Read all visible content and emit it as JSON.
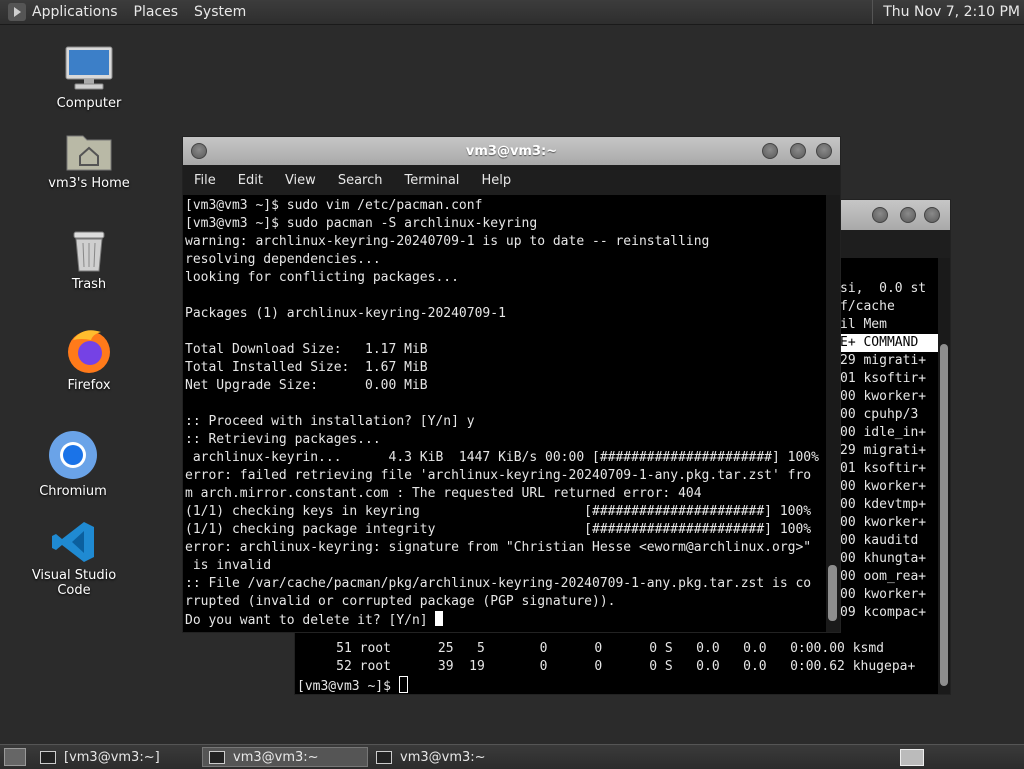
{
  "top_panel": {
    "menus": [
      "Applications",
      "Places",
      "System"
    ],
    "clock": "Thu Nov  7,  2:10 PM"
  },
  "desktop": {
    "icons": [
      {
        "label": "Computer",
        "icon": "computer-icon"
      },
      {
        "label": "vm3's Home",
        "icon": "home-folder-icon"
      },
      {
        "label": "Trash",
        "icon": "trash-icon"
      },
      {
        "label": "Firefox",
        "icon": "firefox-icon"
      },
      {
        "label": "Chromium",
        "icon": "chromium-icon"
      },
      {
        "label": "Visual Studio Code",
        "icon": "vscode-icon"
      }
    ]
  },
  "front_terminal": {
    "title": "vm3@vm3:~",
    "menus": [
      "File",
      "Edit",
      "View",
      "Search",
      "Terminal",
      "Help"
    ],
    "lines": [
      "[vm3@vm3 ~]$ sudo vim /etc/pacman.conf",
      "[vm3@vm3 ~]$ sudo pacman -S archlinux-keyring",
      "warning: archlinux-keyring-20240709-1 is up to date -- reinstalling",
      "resolving dependencies...",
      "looking for conflicting packages...",
      "",
      "Packages (1) archlinux-keyring-20240709-1",
      "",
      "Total Download Size:   1.17 MiB",
      "Total Installed Size:  1.67 MiB",
      "Net Upgrade Size:      0.00 MiB",
      "",
      ":: Proceed with installation? [Y/n] y",
      ":: Retrieving packages...",
      " archlinux-keyrin...      4.3 KiB  1447 KiB/s 00:00 [######################] 100%",
      "error: failed retrieving file 'archlinux-keyring-20240709-1-any.pkg.tar.zst' fro",
      "m arch.mirror.constant.com : The requested URL returned error: 404",
      "(1/1) checking keys in keyring                     [######################] 100%",
      "(1/1) checking package integrity                   [######################] 100%",
      "error: archlinux-keyring: signature from \"Christian Hesse <eworm@archlinux.org>\"",
      " is invalid",
      ":: File /var/cache/pacman/pkg/archlinux-keyring-20240709-1-any.pkg.tar.zst is co",
      "rrupted (invalid or corrupted package (PGP signature)).",
      "Do you want to delete it? [Y/n] "
    ]
  },
  "back_terminal": {
    "right_lines": [
      "si,  0.0 st",
      "f/cache",
      "il Mem",
      "",
      "E+ COMMAND",
      "29 migrati+",
      "01 ksoftir+",
      "00 kworker+",
      "00 cpuhp/3",
      "00 idle_in+",
      "29 migrati+",
      "01 ksoftir+",
      "00 kworker+",
      "00 kdevtmp+",
      "00 kworker+",
      "00 kauditd",
      "00 khungta+",
      "00 oom_rea+",
      "00 kworker+",
      "09 kcompac+"
    ],
    "bottom_lines": [
      "     51 root      25   5       0      0      0 S   0.0   0.0   0:00.00 ksmd",
      "     52 root      39  19       0      0      0 S   0.0   0.0   0:00.62 khugepa+"
    ],
    "prompt": "[vm3@vm3 ~]$ "
  },
  "taskbar": {
    "tasks": [
      "[vm3@vm3:~]",
      "vm3@vm3:~",
      "vm3@vm3:~"
    ]
  }
}
